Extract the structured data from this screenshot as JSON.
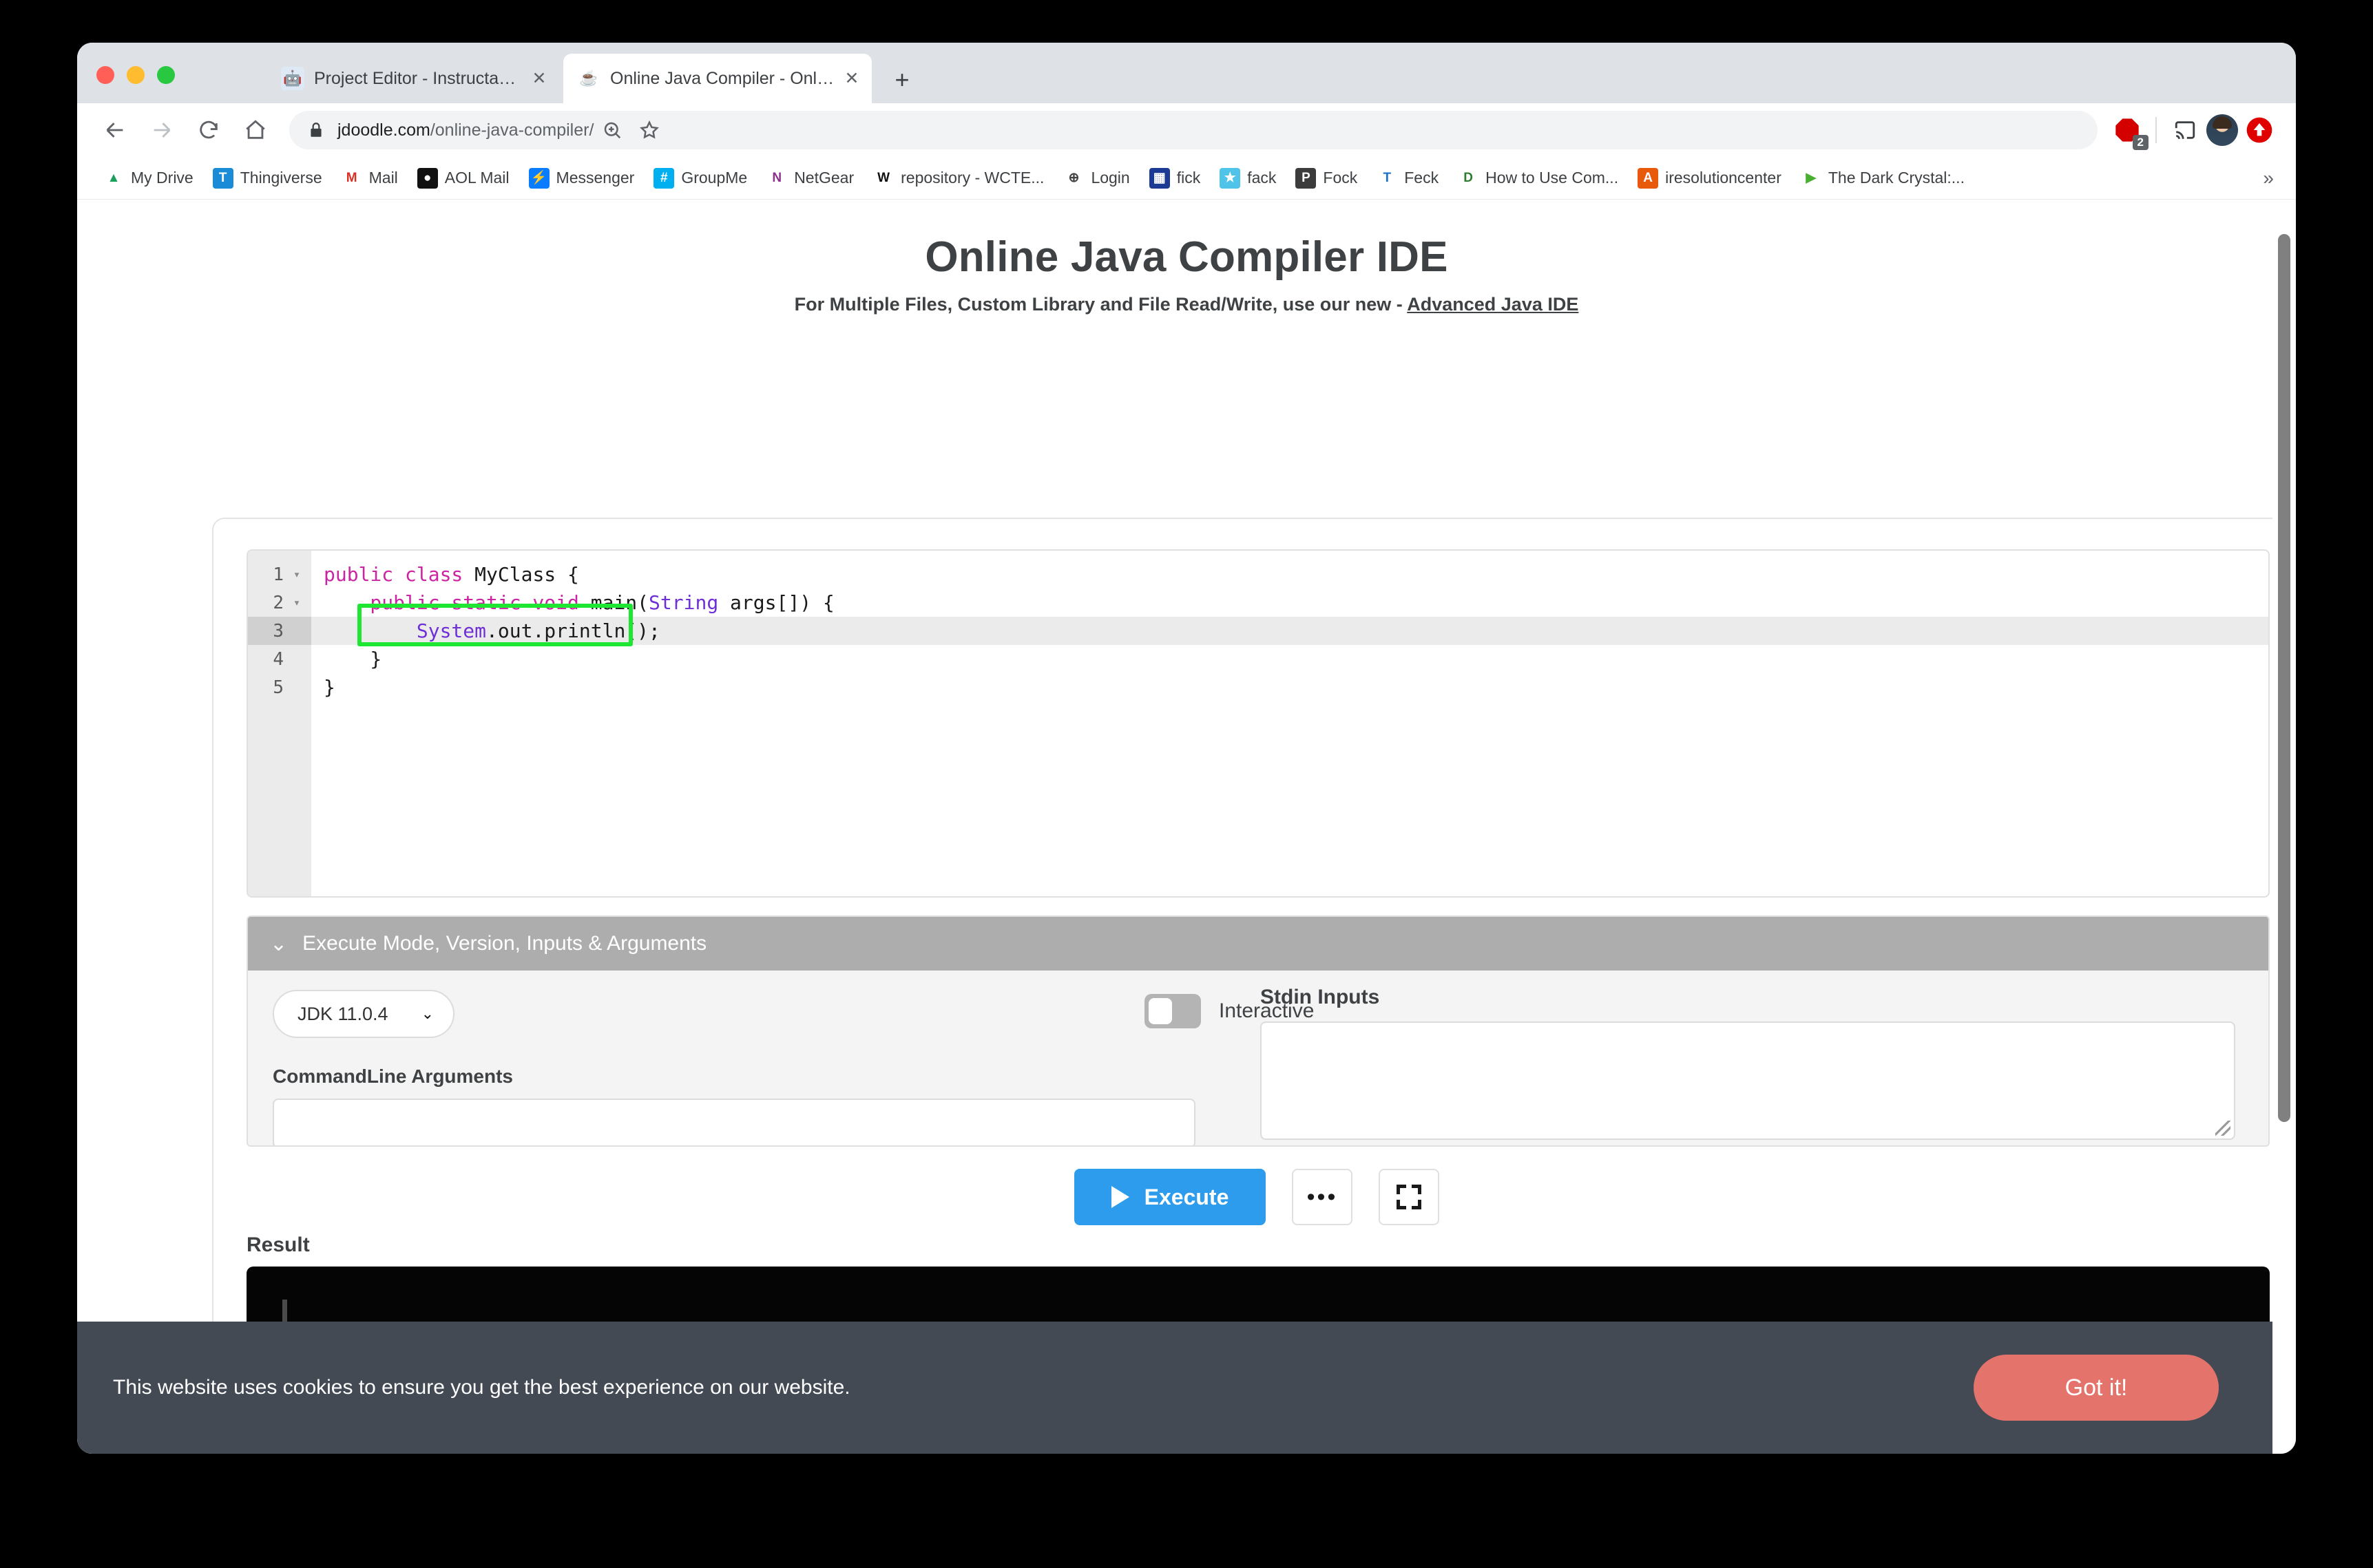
{
  "browser": {
    "tabs": [
      {
        "title": "Project Editor - Instructables",
        "favicon": "instructables-icon",
        "close_label": "✕",
        "active": false
      },
      {
        "title": "Online Java Compiler - Online",
        "favicon": "java-cup-icon",
        "close_label": "✕",
        "active": true
      }
    ],
    "new_tab_label": "+",
    "url_host": "jdoodle.com",
    "url_path": "/online-java-compiler/",
    "adblock_badge": "2",
    "bookmarks": [
      {
        "label": "My Drive",
        "icon": "google-drive-icon",
        "glyph": "▲",
        "bg": "#ffffff",
        "fg": "#1a9f5c"
      },
      {
        "label": "Thingiverse",
        "icon": "thingiverse-icon",
        "glyph": "T",
        "bg": "#1a8bd6",
        "fg": "#ffffff"
      },
      {
        "label": "Mail",
        "icon": "gmail-icon",
        "glyph": "M",
        "bg": "#ffffff",
        "fg": "#d93025"
      },
      {
        "label": "AOL Mail",
        "icon": "aol-mail-icon",
        "glyph": "●",
        "bg": "#111111",
        "fg": "#ffffff"
      },
      {
        "label": "Messenger",
        "icon": "messenger-icon",
        "glyph": "⚡",
        "bg": "#0a7cff",
        "fg": "#ffffff"
      },
      {
        "label": "GroupMe",
        "icon": "groupme-icon",
        "glyph": "#",
        "bg": "#00aff0",
        "fg": "#ffffff"
      },
      {
        "label": "NetGear",
        "icon": "netgear-icon",
        "glyph": "N",
        "bg": "#ffffff",
        "fg": "#8c2f8f"
      },
      {
        "label": "repository - WCTE...",
        "icon": "wct-repository-icon",
        "glyph": "W",
        "bg": "#ffffff",
        "fg": "#111111"
      },
      {
        "label": "Login",
        "icon": "login-globe-icon",
        "glyph": "⊕",
        "bg": "#ffffff",
        "fg": "#444444"
      },
      {
        "label": "fick",
        "icon": "fick-icon",
        "glyph": "▦",
        "bg": "#1b3a93",
        "fg": "#ffffff"
      },
      {
        "label": "fack",
        "icon": "fack-icon",
        "glyph": "★",
        "bg": "#4fc3e8",
        "fg": "#ffffff"
      },
      {
        "label": "Fock",
        "icon": "fock-icon",
        "glyph": "P",
        "bg": "#3c3c3c",
        "fg": "#ffffff"
      },
      {
        "label": "Feck",
        "icon": "tea-icon",
        "glyph": "T",
        "bg": "#ffffff",
        "fg": "#1a73c8"
      },
      {
        "label": "How to Use Com...",
        "icon": "document-icon",
        "glyph": "D",
        "bg": "#ffffff",
        "fg": "#2e7d32"
      },
      {
        "label": "iresolutioncenter",
        "icon": "iresolutioncenter-icon",
        "glyph": "A",
        "bg": "#e8590c",
        "fg": "#ffffff"
      },
      {
        "label": "The Dark Crystal:...",
        "icon": "play-circle-icon",
        "glyph": "▶",
        "bg": "#ffffff",
        "fg": "#49b02f"
      }
    ],
    "bookmarks_overflow": "»"
  },
  "page": {
    "title": "Online Java Compiler IDE",
    "subtitle_prefix": "For Multiple Files, Custom Library and File Read/Write, use our new - ",
    "advanced_link": "Advanced Java IDE"
  },
  "editor": {
    "lines": [
      {
        "number": "1",
        "fold": "▾",
        "active": false
      },
      {
        "number": "2",
        "fold": "▾",
        "active": false
      },
      {
        "number": "3",
        "fold": "",
        "active": true
      },
      {
        "number": "4",
        "fold": "",
        "active": false
      },
      {
        "number": "5",
        "fold": "",
        "active": false
      }
    ],
    "code": {
      "l1_kw": "public class",
      "l1_rest": " MyClass {",
      "l2_kw": "    public static void",
      "l2_mid": " main(",
      "l2_type": "String",
      "l2_rest": " args[]) {",
      "l3_type": "        System",
      "l3_rest": ".out.println();",
      "l4": "    }",
      "l5": "}"
    },
    "highlight_color": "#1fe633"
  },
  "options": {
    "header_title": "Execute Mode, Version, Inputs & Arguments",
    "header_caret": "⌄",
    "version": "JDK 11.0.4",
    "version_caret": "⌄",
    "commandline_label": "CommandLine Arguments",
    "commandline_value": "",
    "interactive_label": "Interactive",
    "interactive_on": false,
    "stdin_label": "Stdin Inputs",
    "stdin_value": ""
  },
  "actions": {
    "execute_label": "Execute",
    "more_label": "•••",
    "fullscreen_name": "fullscreen-icon"
  },
  "result": {
    "label": "Result",
    "output": ""
  },
  "cookie": {
    "message": "This website uses cookies to ensure you get the best experience on our website.",
    "accept_label": "Got it!"
  },
  "colors": {
    "accent_blue": "#2e9ced",
    "cookie_bg": "#434a54",
    "cookie_btn": "#e4736c",
    "panel_header": "#adadad",
    "console_bg": "#050505"
  }
}
